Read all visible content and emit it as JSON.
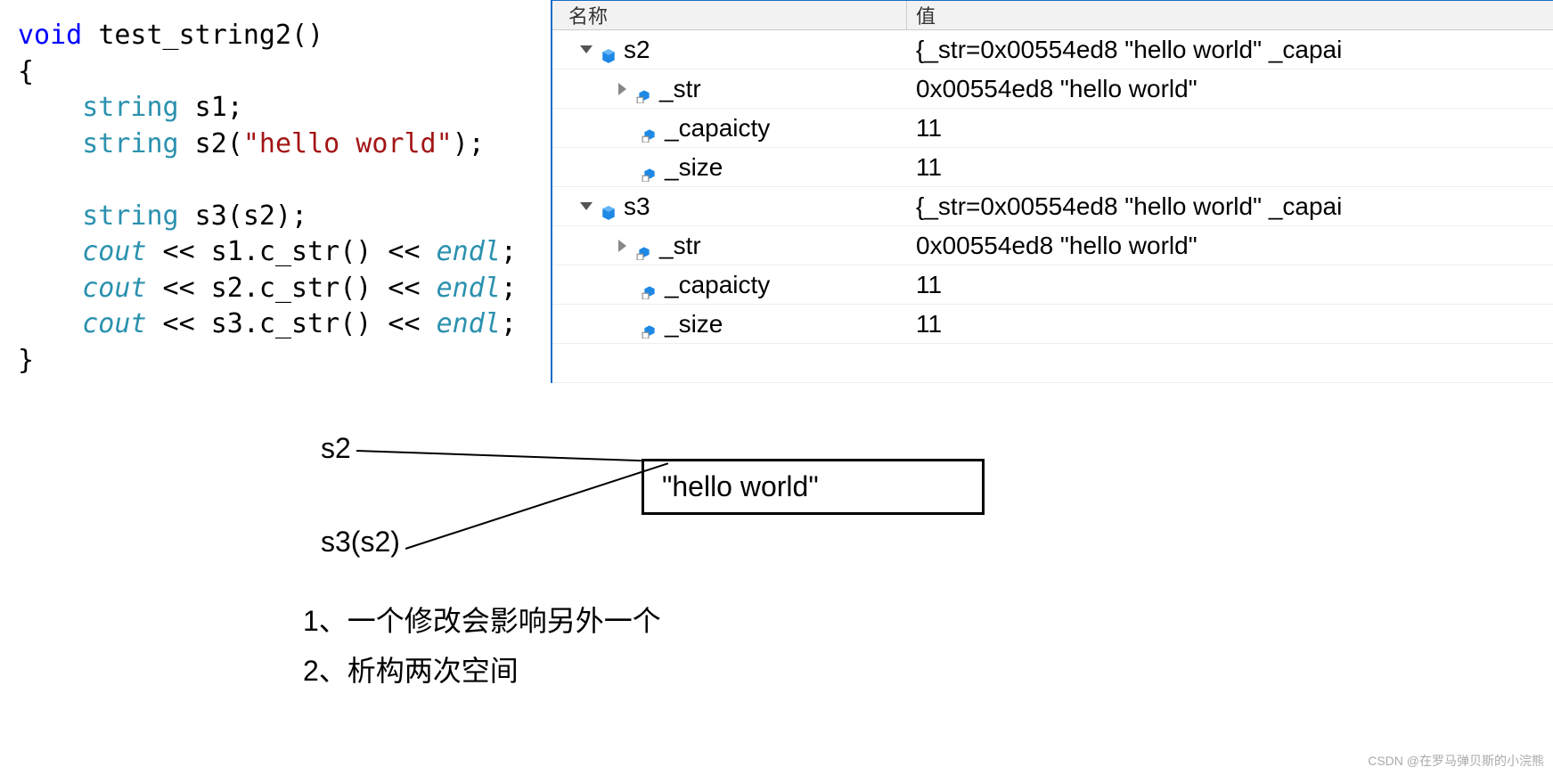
{
  "code": {
    "l1_kw": "void",
    "l1_fn": "test_string2()",
    "l2": "{",
    "l3_type": "string",
    "l3_rest": " s1;",
    "l4_type": "string",
    "l4_rest": " s2(",
    "l4_str": "\"hello world\"",
    "l4_end": ");",
    "l5_type": "string",
    "l5_rest": " s3(s2);",
    "l6_cout": "cout",
    "l6_mid": " << s1.c_str() << ",
    "l6_endl": "endl",
    "l6_end": ";",
    "l7_cout": "cout",
    "l7_mid": " << s2.c_str() << ",
    "l7_endl": "endl",
    "l7_end": ";",
    "l8_cout": "cout",
    "l8_mid": " << s3.c_str() << ",
    "l8_endl": "endl",
    "l8_end": ";",
    "l9": "}"
  },
  "watch": {
    "header_name": "名称",
    "header_value": "值",
    "rows": [
      {
        "name": "s2",
        "value": "{_str=0x00554ed8 \"hello world\" _capai"
      },
      {
        "name": "_str",
        "value": "0x00554ed8 \"hello world\""
      },
      {
        "name": "_capaicty",
        "value": "11"
      },
      {
        "name": "_size",
        "value": "11"
      },
      {
        "name": "s3",
        "value": "{_str=0x00554ed8 \"hello world\" _capai"
      },
      {
        "name": "_str",
        "value": "0x00554ed8 \"hello world\""
      },
      {
        "name": "_capaicty",
        "value": "11"
      },
      {
        "name": "_size",
        "value": "11"
      }
    ]
  },
  "diagram": {
    "s2_label": "s2",
    "s3_label": "s3(s2)",
    "box_text": "\"hello world\""
  },
  "notes": {
    "n1": "1、一个修改会影响另外一个",
    "n2": "2、析构两次空间"
  },
  "watermark": "CSDN @在罗马弹贝斯的小浣熊"
}
